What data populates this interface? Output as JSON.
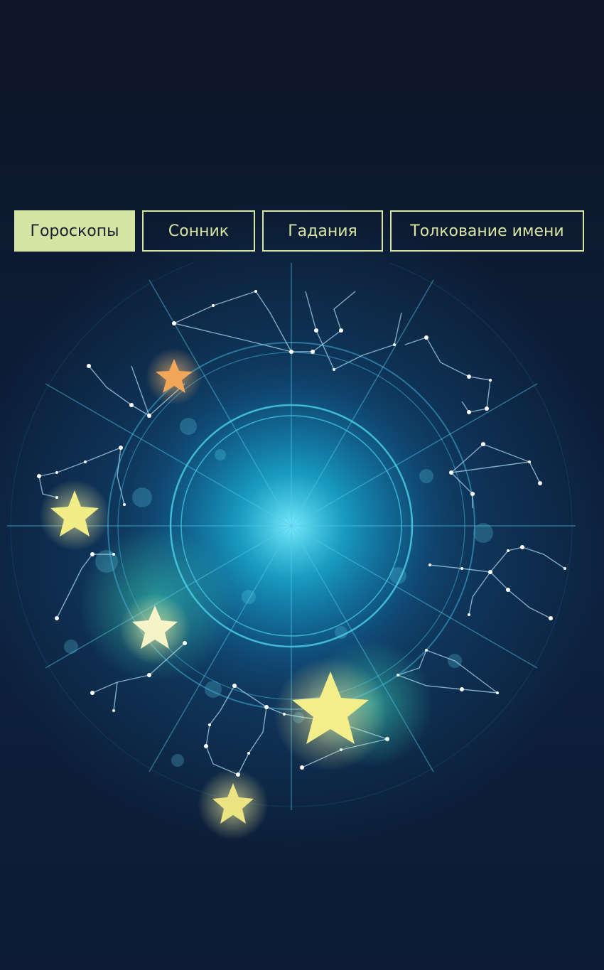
{
  "nav": {
    "tabs": [
      {
        "label": "Гороскопы",
        "active": true
      },
      {
        "label": "Сонник",
        "active": false
      },
      {
        "label": "Гадания",
        "active": false
      },
      {
        "label": "Толкование имени",
        "active": false
      }
    ]
  },
  "hero": {
    "image": "zodiac-wheel-illustration",
    "icon_names": [
      "star-icon",
      "constellation-icon"
    ]
  },
  "colors": {
    "tab_border": "#d6e6a2",
    "tab_active_bg": "#d4e4a2",
    "background": "#0d1a30",
    "glow": "#00b4e6",
    "star_yellow": "#f3ee8a",
    "star_orange": "#f2a65a"
  }
}
